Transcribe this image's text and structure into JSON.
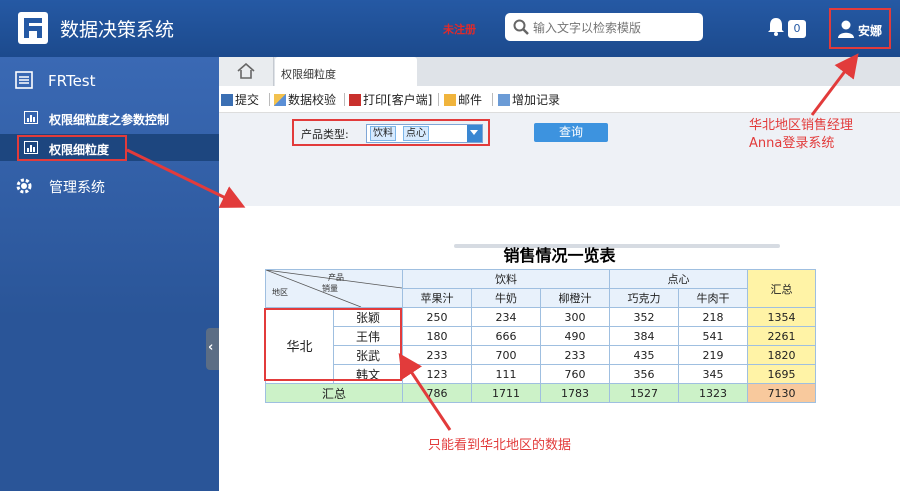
{
  "header": {
    "app_title": "数据决策系统",
    "unregistered": "未注册",
    "search_placeholder": "输入文字以检索模版",
    "notification_count": "0",
    "user_name": "安娜"
  },
  "sidebar": {
    "root_label": "FRTest",
    "items": [
      {
        "label": "权限细粒度之参数控制"
      },
      {
        "label": "权限细粒度"
      },
      {
        "label": "管理系统"
      }
    ],
    "collapse_glyph": "‹"
  },
  "tabs": {
    "active_label": "权限细粒度"
  },
  "toolbar": {
    "submit": "提交",
    "validate": "数据校验",
    "print": "打印[客户端]",
    "mail": "邮件",
    "add_record": "增加记录"
  },
  "params": {
    "label": "产品类型:",
    "chips": [
      "饮料",
      "点心"
    ],
    "query_button": "查询"
  },
  "report": {
    "title": "销售情况一览表",
    "corner": {
      "product": "产品",
      "sales": "销量",
      "region": "地区"
    },
    "group_headers": [
      "饮料",
      "点心"
    ],
    "total_header": "汇总",
    "products": [
      "苹果汁",
      "牛奶",
      "柳橙汁",
      "巧克力",
      "牛肉干"
    ],
    "region": "华北",
    "rows": [
      {
        "name": "张颖",
        "values": [
          "250",
          "234",
          "300",
          "352",
          "218"
        ],
        "total": "1354"
      },
      {
        "name": "王伟",
        "values": [
          "180",
          "666",
          "490",
          "384",
          "541"
        ],
        "total": "2261"
      },
      {
        "name": "张武",
        "values": [
          "233",
          "700",
          "233",
          "435",
          "219"
        ],
        "total": "1820"
      },
      {
        "name": "韩文",
        "values": [
          "123",
          "111",
          "760",
          "356",
          "345"
        ],
        "total": "1695"
      }
    ],
    "summary": {
      "label": "汇总",
      "values": [
        "786",
        "1711",
        "1783",
        "1527",
        "1323"
      ],
      "total": "7130"
    }
  },
  "annotations": {
    "login_note_line1": "华北地区销售经理",
    "login_note_line2": "Anna登录系统",
    "data_note": "只能看到华北地区的数据"
  },
  "colors": {
    "header_blue": "#2559a4",
    "annotation_red": "#e23b3b",
    "total_yellow": "#fff3a6",
    "summary_green": "#ccf2c8",
    "grand_total_orange": "#f8c99d"
  }
}
